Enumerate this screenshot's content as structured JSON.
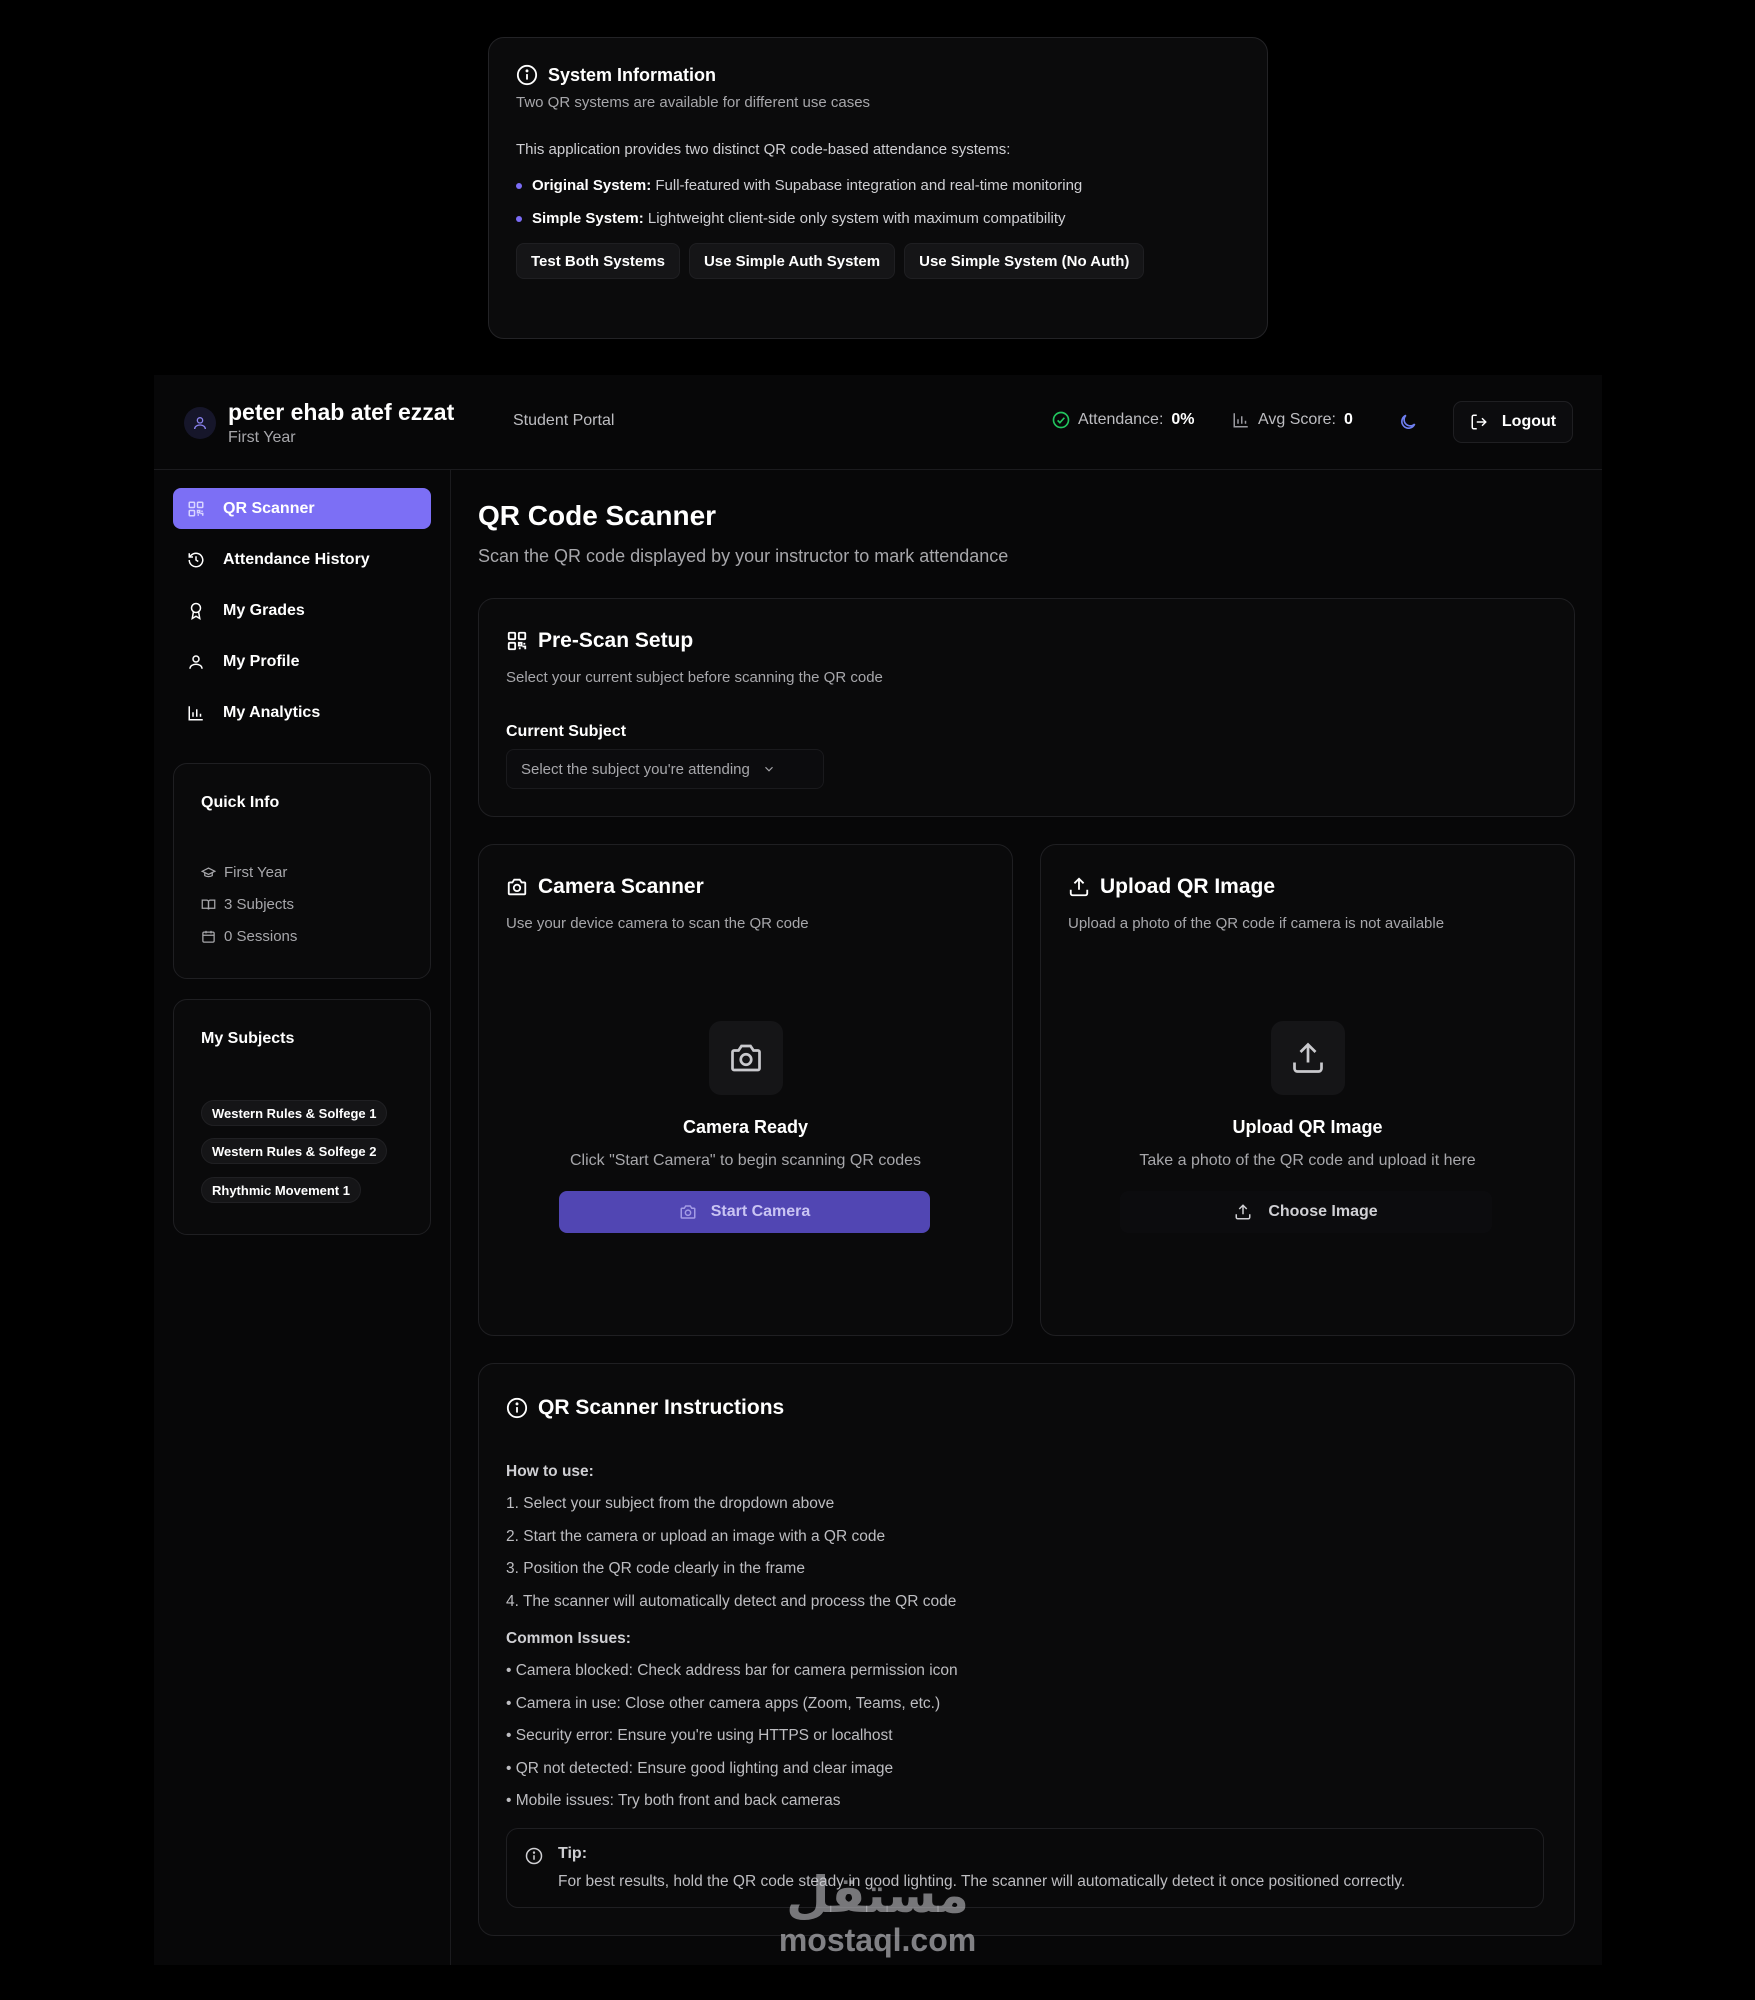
{
  "system_info": {
    "title": "System Information",
    "subtitle": "Two QR systems are available for different use cases",
    "description": "This application provides two distinct QR code-based attendance systems:",
    "items": [
      {
        "name": "Original System:",
        "text": " Full-featured with Supabase integration and real-time monitoring"
      },
      {
        "name": "Simple System:",
        "text": " Lightweight client-side only system with maximum compatibility"
      }
    ],
    "buttons": [
      "Test Both Systems",
      "Use Simple Auth System",
      "Use Simple System (No Auth)"
    ]
  },
  "header": {
    "user_name": "peter ehab atef ezzat",
    "user_year": "First Year",
    "portal": "Student Portal",
    "attendance_label": "Attendance:",
    "attendance_value": "0%",
    "avg_label": "Avg Score:",
    "avg_value": "0",
    "logout": "Logout"
  },
  "sidebar": {
    "nav": [
      {
        "label": "QR Scanner",
        "icon": "qr-icon",
        "active": true
      },
      {
        "label": "Attendance History",
        "icon": "history-icon"
      },
      {
        "label": "My Grades",
        "icon": "award-icon"
      },
      {
        "label": "My Profile",
        "icon": "user-icon"
      },
      {
        "label": "My Analytics",
        "icon": "bar-chart-icon"
      }
    ],
    "quick_info": {
      "title": "Quick Info",
      "items": [
        "First Year",
        "3 Subjects",
        "0 Sessions"
      ]
    },
    "subjects": {
      "title": "My Subjects",
      "items": [
        "Western Rules & Solfege 1",
        "Western Rules & Solfege 2",
        "Rhythmic Movement 1"
      ]
    }
  },
  "main": {
    "title": "QR Code Scanner",
    "subtitle": "Scan the QR code displayed by your instructor to mark attendance",
    "prescan": {
      "title": "Pre-Scan Setup",
      "subtitle": "Select your current subject before scanning the QR code",
      "label": "Current Subject",
      "select_placeholder": "Select the subject you're attending"
    },
    "camera": {
      "title": "Camera Scanner",
      "subtitle": "Use your device camera to scan the QR code",
      "status": "Camera Ready",
      "hint": "Click \"Start Camera\" to begin scanning QR codes",
      "button": "Start Camera"
    },
    "upload": {
      "title": "Upload QR Image",
      "subtitle": "Upload a photo of the QR code if camera is not available",
      "status": "Upload QR Image",
      "hint": "Take a photo of the QR code and upload it here",
      "button": "Choose Image"
    },
    "instructions": {
      "title": "QR Scanner Instructions",
      "how_title": "How to use:",
      "steps": [
        "1. Select your subject from the dropdown above",
        "2. Start the camera or upload an image with a QR code",
        "3. Position the QR code clearly in the frame",
        "4. The scanner will automatically detect and process the QR code"
      ],
      "issues_title": "Common Issues:",
      "issues": [
        "• Camera blocked: Check address bar for camera permission icon",
        "• Camera in use: Close other camera apps (Zoom, Teams, etc.)",
        "• Security error: Ensure you're using HTTPS or localhost",
        "• QR not detected: Ensure good lighting and clear image",
        "• Mobile issues: Try both front and back cameras"
      ],
      "tip_title": "Tip:",
      "tip_text": "For best results, hold the QR code steady in good lighting. The scanner will automatically detect it once positioned correctly."
    }
  },
  "watermark": {
    "arabic": "مستقل",
    "latin": "mostaql.com"
  },
  "colors": {
    "accent": "#7c6ff5",
    "button": "#5146b3",
    "success": "#22c55e",
    "background": "#000000"
  }
}
